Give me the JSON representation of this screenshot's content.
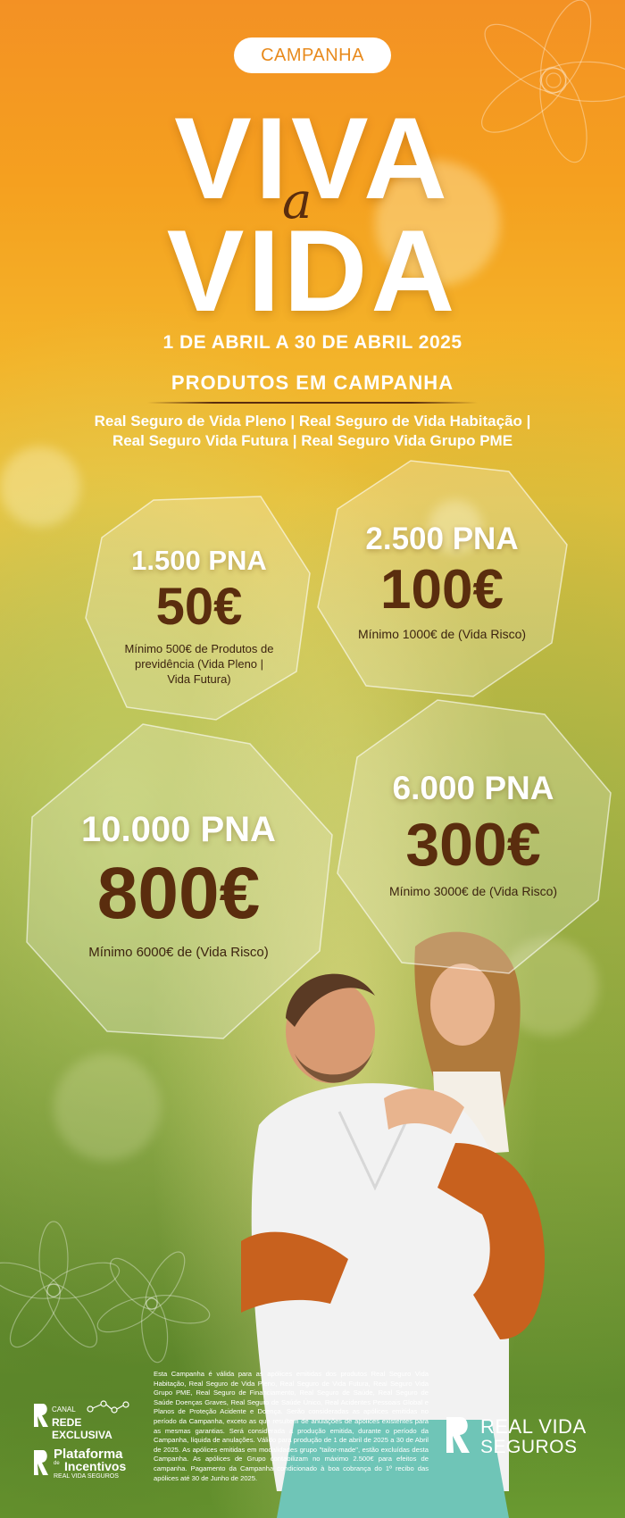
{
  "campaign_badge": "CAMPANHA",
  "headline": {
    "line1": "VIVA",
    "connector": "a",
    "line2": "VIDA"
  },
  "dates": "1 DE ABRIL A 30 DE ABRIL 2025",
  "products": {
    "title": "PRODUTOS EM CAMPANHA",
    "line1": "Real Seguro de Vida Pleno | Real Seguro de Vida Habitação |",
    "line2": "Real Seguro Vida Futura  | Real Seguro Vida Grupo PME"
  },
  "tiers": [
    {
      "pna": "1.500 PNA",
      "amount": "50€",
      "note1": "Mínimo 500€ de Produtos de",
      "note2": "previdência (Vida Pleno |",
      "note3": "Vida Futura)"
    },
    {
      "pna": "2.500 PNA",
      "amount": "100€",
      "note1": "Mínimo 1000€ de (Vida Risco)"
    },
    {
      "pna": "10.000 PNA",
      "amount": "800€",
      "note1": "Mínimo 6000€ de (Vida Risco)"
    },
    {
      "pna": "6.000 PNA",
      "amount": "300€",
      "note1": "Mínimo 3000€ de (Vida Risco)"
    }
  ],
  "disclaimer": "Esta Campanha é válida para as apólices emitidas dos produtos Real Seguro Vida Habitação, Real Seguro de Vida Pleno, Real Seguro de Vida Futura, Real Seguro Vida Grupo PME, Real Seguro de Financiamento, Real Seguro de Saúde, Real Seguro de Saúde Doenças Graves, Real Seguro de Saúde Único, Real Acidentes Pessoais Global e Planos de Proteção Acidente e Doença. Serão consideradas as apólices emitidas no período da Campanha, exceto as que resultem de anulações de apólices existentes para as mesmas garantias. Será considerada a produção emitida, durante o período da Campanha, líquida de anulações. Válido para produção de 1 de abril de 2025 a 30 de Abril de 2025. As apólices emitidas em modalidades grupo \"tailor-made\", estão excluídas desta Campanha. As apólices de Grupo contabilizam no máximo 2.500€ para efeitos de campanha. Pagamento da Campanha condicionado à boa cobrança do 1º recibo das apólices até 30 de Junho de 2025.",
  "logos": {
    "canal_small": "CANAL",
    "canal_main": "REDE EXCLUSIVA",
    "plataforma_line1": "Plataforma",
    "plataforma_de": "de",
    "plataforma_line2": "Incentivos",
    "plataforma_line3": "REAL VIDA SEGUROS",
    "brand_line1": "REAL VIDA",
    "brand_line2": "SEGUROS"
  },
  "colors": {
    "orange": "#f39124",
    "brown": "#5a2d0e",
    "white": "#ffffff",
    "green": "#5d8a2c"
  }
}
